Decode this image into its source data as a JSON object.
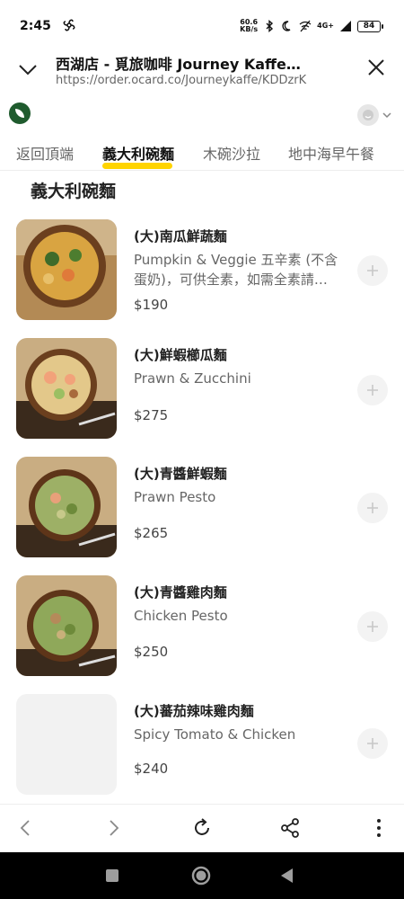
{
  "status_bar": {
    "time": "2:45",
    "net_speed_value": "60.6",
    "net_speed_unit": "KB/s",
    "network_label": "4G+",
    "battery": "84"
  },
  "browser": {
    "title": "西湖店 - 覓旅咖啡 Journey Kaffe…",
    "url": "https://order.ocard.co/Journeykaffe/KDDzrK"
  },
  "tabs": [
    {
      "label": "返回頂端"
    },
    {
      "label": "義大利碗麵"
    },
    {
      "label": "木碗沙拉"
    },
    {
      "label": "地中海早午餐"
    }
  ],
  "section": {
    "title": "義大利碗麵"
  },
  "menu_items": [
    {
      "name": "(大)南瓜鮮蔬麵",
      "desc": "Pumpkin & Veggie 五辛素 (不含蛋奶)，可供全素，如需全素請…",
      "price": "$190"
    },
    {
      "name": "(大)鮮蝦櫛瓜麵",
      "desc": "Prawn & Zucchini",
      "price": "$275"
    },
    {
      "name": "(大)青醬鮮蝦麵",
      "desc": "Prawn Pesto",
      "price": "$265"
    },
    {
      "name": "(大)青醬雞肉麵",
      "desc": "Chicken Pesto",
      "price": "$250"
    },
    {
      "name": "(大)蕃茄辣味雞肉麵",
      "desc": "Spicy Tomato & Chicken",
      "price": "$240"
    }
  ],
  "colors": {
    "tab_underline": "#ffd400",
    "system_nav": "#000000",
    "add_button_bg": "#f3f3f3"
  },
  "icons": {
    "collapse": "chevron-down-icon",
    "close": "close-icon",
    "back": "arrow-left-icon",
    "forward": "arrow-right-icon",
    "refresh": "refresh-icon",
    "share": "share-icon",
    "more": "more-vertical-icon"
  }
}
